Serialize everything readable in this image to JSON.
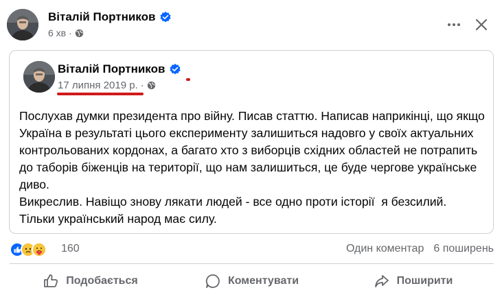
{
  "post": {
    "author": "Віталій Портников",
    "time": "6 хв",
    "shared": {
      "author": "Віталій Портников",
      "date": "17 липня 2019 р.",
      "separator": "·",
      "paragraphs": [
        "Послухав думки президента про війну. Писав статтю. Написав наприкінці, що якщо Україна в результаті цього експерименту залишиться надовго у своїх актуальних контрольованих кордонах, а багато хто з виборців східних областей не потрапить до таборів біженців на території, що нам залишиться, це буде чергове українське диво.",
        "Викреслив. Навіщо знову лякати людей - все одно проти історії  я безсилий.",
        "Тільки український народ має силу."
      ]
    },
    "reactions": {
      "count": "160",
      "icons": [
        "like-icon",
        "sad-icon",
        "care-icon"
      ]
    },
    "stats": {
      "comments": "Один коментар",
      "shares": "6 поширень"
    },
    "actions": {
      "like": "Подобається",
      "comment": "Коментувати",
      "share": "Поширити"
    }
  },
  "colors": {
    "accent": "#0866ff",
    "secondary_text": "#65676b",
    "annotation": "#d11a1a"
  }
}
